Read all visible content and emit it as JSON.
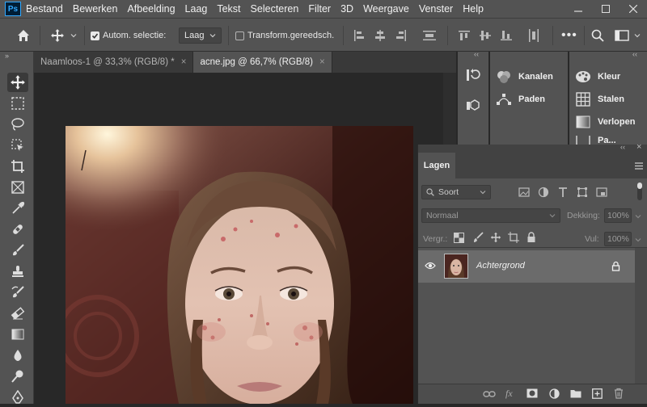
{
  "app": {
    "logo_text": "Ps",
    "menu": [
      "Bestand",
      "Bewerken",
      "Afbeelding",
      "Laag",
      "Tekst",
      "Selecteren",
      "Filter",
      "3D",
      "Weergave",
      "Venster",
      "Help"
    ]
  },
  "options": {
    "auto_select_label": "Autom. selectie:",
    "auto_select_checked": true,
    "auto_select_target": "Laag",
    "transform_label": "Transform.gereedsch.",
    "transform_checked": false,
    "more": "•••"
  },
  "tabs": [
    {
      "label": "Naamloos-1 @ 33,3% (RGB/8) *",
      "active": false,
      "close": "×"
    },
    {
      "label": "acne.jpg @ 66,7% (RGB/8)",
      "active": true,
      "close": "×"
    }
  ],
  "dock": {
    "collapse_left": "‹‹",
    "collapse_right": "‹‹",
    "channels": "Kanalen",
    "paths": "Paden",
    "color": "Kleur",
    "swatches": "Stalen",
    "gradients": "Verlopen",
    "patterns_partial": "Pa..."
  },
  "layers": {
    "tab_label": "Lagen",
    "kind_filter": "Soort",
    "blend_mode": "Normaal",
    "opacity_label": "Dekking:",
    "opacity_value": "100%",
    "lock_label": "Vergr.:",
    "fill_label": "Vul:",
    "fill_value": "100%",
    "items": [
      {
        "name": "Achtergrond",
        "visible": true,
        "locked": true
      }
    ]
  }
}
